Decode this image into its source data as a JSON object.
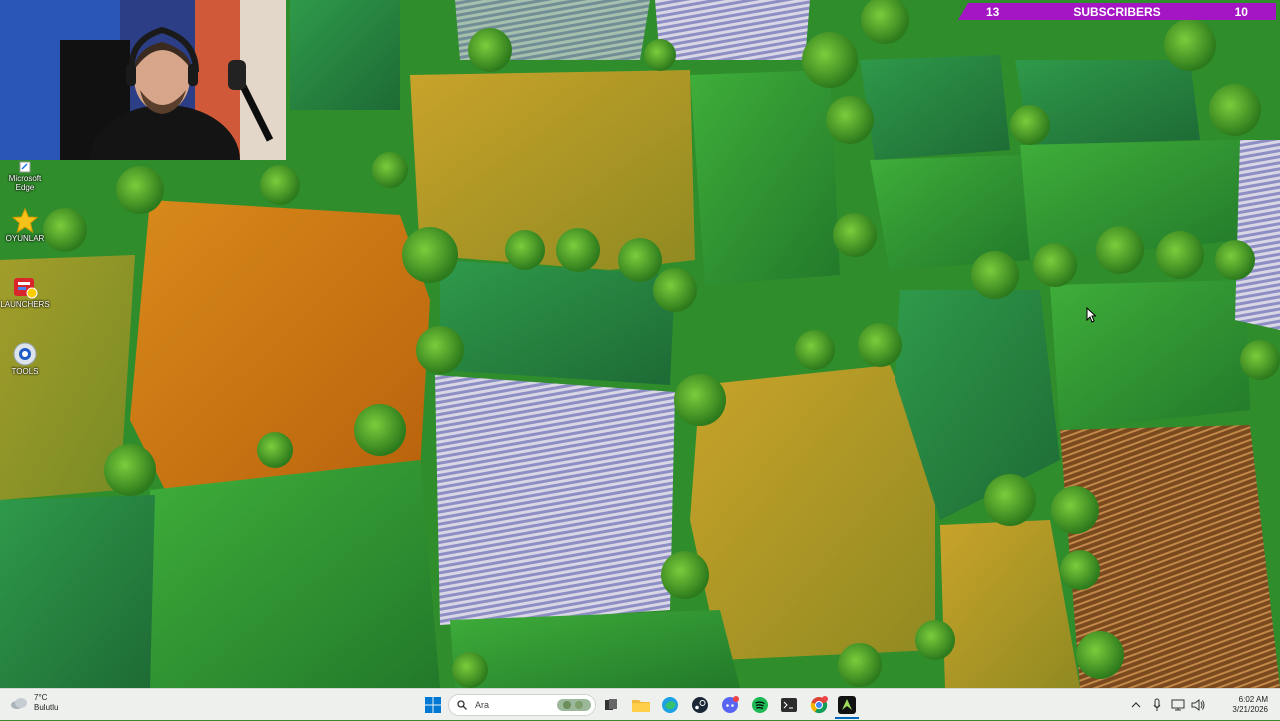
{
  "subscribers": {
    "current": "13",
    "label": "SUBSCRIBERS",
    "goal": "10"
  },
  "desktop_icons": [
    {
      "label": "Microsoft\nEdge",
      "icon": "edge-icon"
    },
    {
      "label": "OYUNLAR",
      "icon": "star-folder-icon"
    },
    {
      "label": "LAUNCHERS",
      "icon": "launchers-icon"
    },
    {
      "label": "TOOLS",
      "icon": "tools-icon"
    }
  ],
  "weather": {
    "temp": "7°C",
    "condition": "Bulutlu",
    "icon": "cloud-icon"
  },
  "search": {
    "placeholder": "Ara"
  },
  "taskbar_apps": [
    "start-icon",
    "task-view-icon",
    "file-explorer-icon",
    "edge-icon",
    "steam-icon",
    "discord-icon",
    "spotify-icon",
    "terminal-icon",
    "chrome-icon",
    "obs-icon"
  ],
  "clock": {
    "time": "6:02 AM",
    "date": "3/21/2026"
  },
  "colors": {
    "banner": "#a416c4",
    "taskbar": "#eef0ee",
    "accent": "#0067c0"
  }
}
